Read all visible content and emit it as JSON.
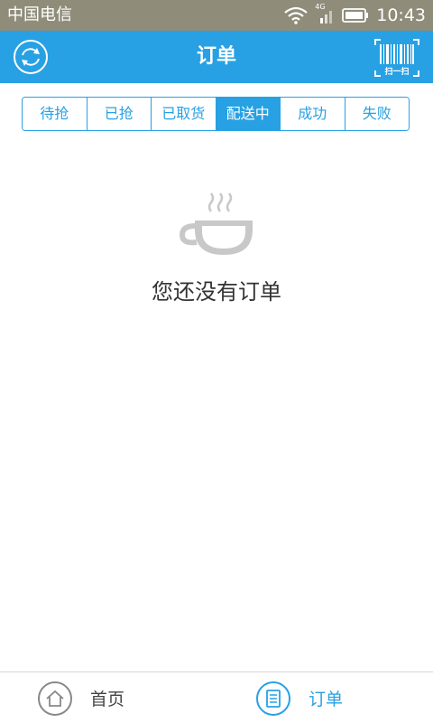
{
  "status_bar": {
    "carrier": "中国电信",
    "network": "4G",
    "time": "10:43",
    "icons": [
      "wifi-icon",
      "signal-icon",
      "battery-icon"
    ]
  },
  "header": {
    "title": "订单",
    "scan_label": "扫一扫",
    "left_icon": "refresh-icon",
    "right_icon": "barcode-scan-icon"
  },
  "tabs": [
    {
      "label": "待抢",
      "active": false
    },
    {
      "label": "已抢",
      "active": false
    },
    {
      "label": "已取货",
      "active": false
    },
    {
      "label": "配送中",
      "active": true
    },
    {
      "label": "成功",
      "active": false
    },
    {
      "label": "失败",
      "active": false
    }
  ],
  "empty_state": {
    "icon": "coffee-cup-icon",
    "message": "您还没有订单"
  },
  "bottom_nav": {
    "home_label": "首页",
    "orders_label": "订单",
    "active": "orders"
  },
  "colors": {
    "primary": "#27a1e3",
    "status_bar": "#8f8c7a",
    "text": "#333333",
    "icon_gray": "#c8c8c8"
  }
}
